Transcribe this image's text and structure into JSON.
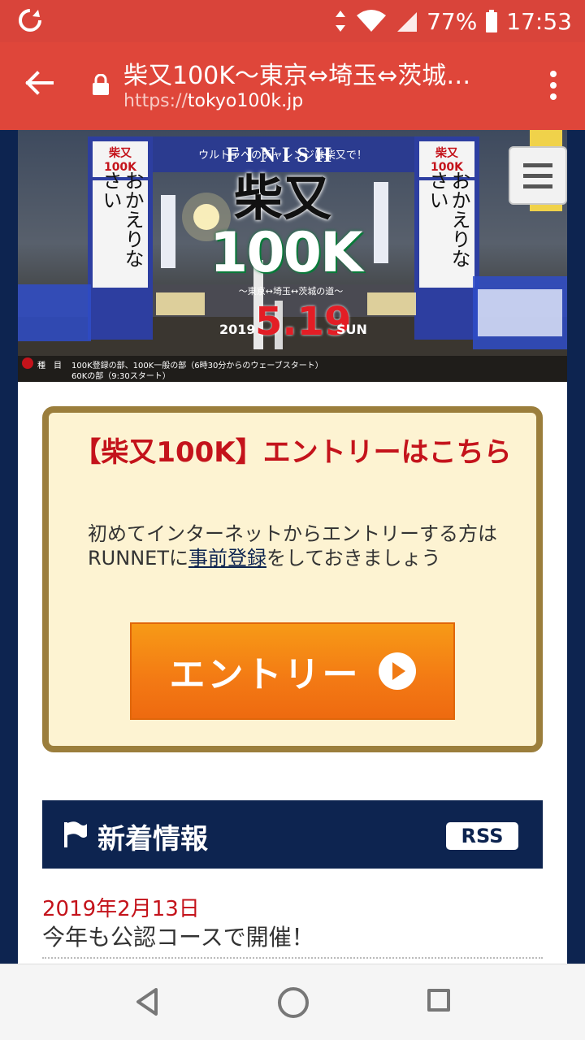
{
  "status_bar": {
    "battery": "77%",
    "time": "17:53"
  },
  "url_bar": {
    "title": "柴又100K〜東京⇔埼玉⇔茨城…",
    "url_scheme": "https://",
    "url_host": "tokyo100k.jp"
  },
  "hero": {
    "gate_banner": "FINISH",
    "catch": "ウルトラへのチャレンジは柴又で！",
    "logo": "柴又",
    "logo_sub": "100K",
    "route": "〜東京↔埼玉↔茨城の道〜",
    "year": "2019",
    "date": "5.19",
    "weekday": "SUN",
    "pillar_text_left": "おかえりなさい",
    "pillar_text_right": "おかえりなさい",
    "pillar_brand": "柴又100K",
    "caption_label": "種　目",
    "caption_line1": "100K登録の部、100K一般の部（6時30分からのウェーブスタート）",
    "caption_line2": "60Kの部（9:30スタート）"
  },
  "entry": {
    "title": "【柴又100K】エントリーはこちら",
    "desc_before": "初めてインターネットからエントリーする方はRUNNETに",
    "desc_link": "事前登録",
    "desc_after": "をしておきましょう",
    "button_label": "エントリー"
  },
  "news": {
    "heading": "新着情報",
    "rss": "RSS",
    "items": [
      {
        "date": "2019年2月13日",
        "title": "今年も公認コースで開催！"
      }
    ]
  },
  "colors": {
    "chrome": "#df463a",
    "navy": "#0d2450",
    "accent_red": "#c4131b",
    "entry_orange": "#f37914"
  }
}
